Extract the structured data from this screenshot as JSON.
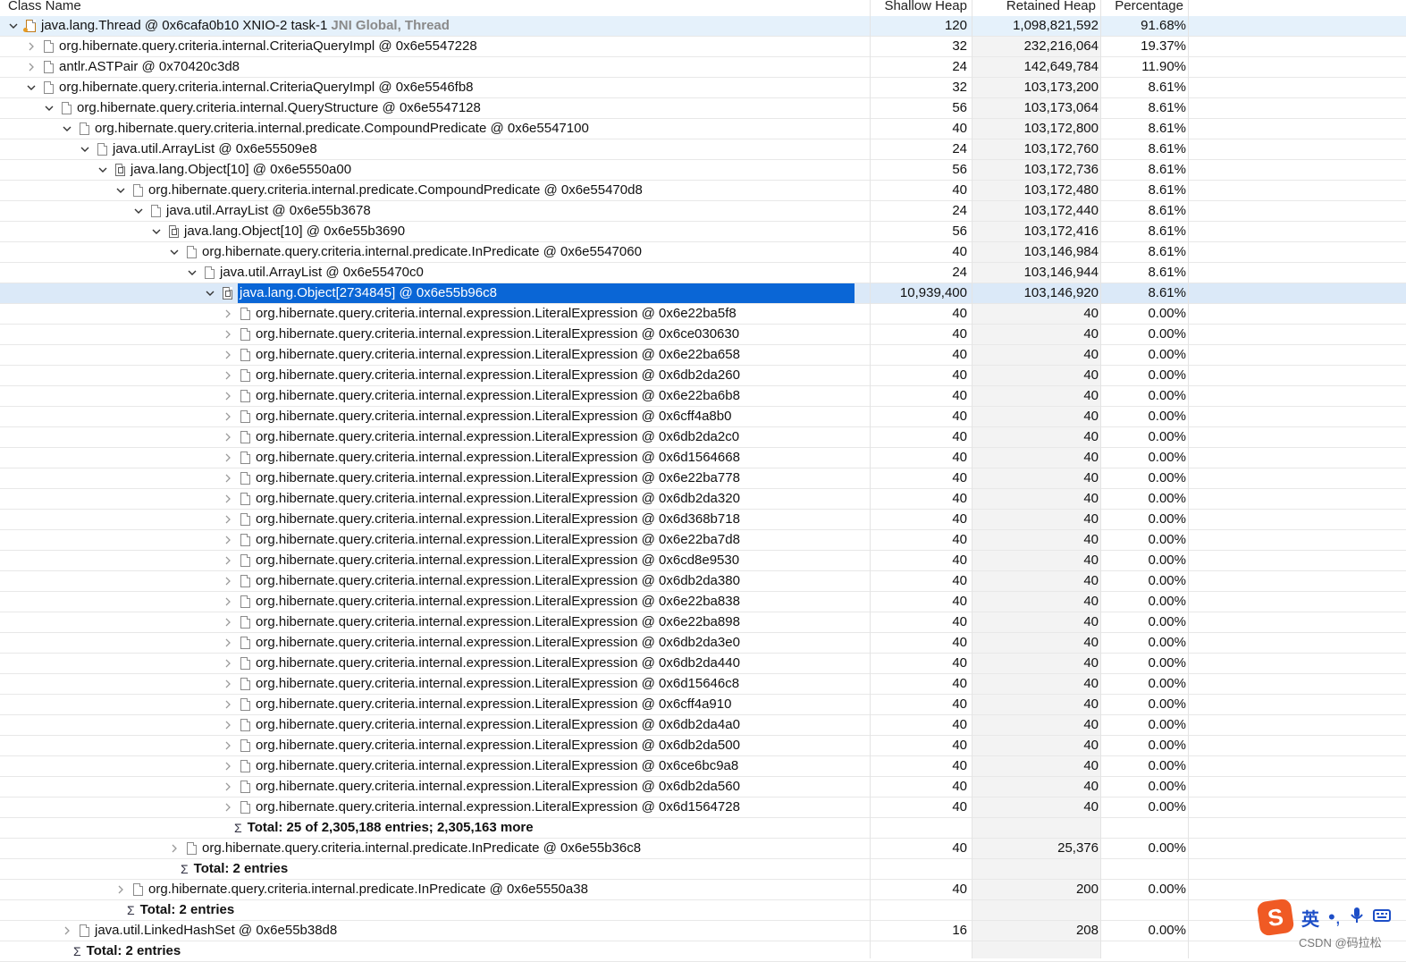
{
  "columns": [
    "Class Name",
    "Shallow Heap",
    "Retained Heap",
    "Percentage"
  ],
  "rows": [
    {
      "depth": 0,
      "tog": "open",
      "icon": "thread",
      "name": "java.lang.Thread @ 0x6cafa0b10  XNIO-2 task-1",
      "gc": "JNI Global, Thread",
      "shallow": "120",
      "retained": "1,098,821,592",
      "pct": "91.68%"
    },
    {
      "depth": 1,
      "tog": "closed",
      "icon": "page",
      "name": "org.hibernate.query.criteria.internal.CriteriaQueryImpl @ 0x6e5547228",
      "shallow": "32",
      "retained": "232,216,064",
      "pct": "19.37%"
    },
    {
      "depth": 1,
      "tog": "closed",
      "icon": "page",
      "name": "antlr.ASTPair @ 0x70420c3d8",
      "shallow": "24",
      "retained": "142,649,784",
      "pct": "11.90%"
    },
    {
      "depth": 1,
      "tog": "open",
      "icon": "page",
      "name": "org.hibernate.query.criteria.internal.CriteriaQueryImpl @ 0x6e5546fb8",
      "shallow": "32",
      "retained": "103,173,200",
      "pct": "8.61%"
    },
    {
      "depth": 2,
      "tog": "open",
      "icon": "page",
      "name": "org.hibernate.query.criteria.internal.QueryStructure @ 0x6e5547128",
      "shallow": "56",
      "retained": "103,173,064",
      "pct": "8.61%"
    },
    {
      "depth": 3,
      "tog": "open",
      "icon": "page",
      "name": "org.hibernate.query.criteria.internal.predicate.CompoundPredicate @ 0x6e5547100",
      "shallow": "40",
      "retained": "103,172,800",
      "pct": "8.61%"
    },
    {
      "depth": 4,
      "tog": "open",
      "icon": "page",
      "name": "java.util.ArrayList @ 0x6e55509e8",
      "shallow": "24",
      "retained": "103,172,760",
      "pct": "8.61%"
    },
    {
      "depth": 5,
      "tog": "open",
      "icon": "array",
      "name": "java.lang.Object[10] @ 0x6e5550a00",
      "shallow": "56",
      "retained": "103,172,736",
      "pct": "8.61%"
    },
    {
      "depth": 6,
      "tog": "open",
      "icon": "page",
      "name": "org.hibernate.query.criteria.internal.predicate.CompoundPredicate @ 0x6e55470d8",
      "shallow": "40",
      "retained": "103,172,480",
      "pct": "8.61%"
    },
    {
      "depth": 7,
      "tog": "open",
      "icon": "page",
      "name": "java.util.ArrayList @ 0x6e55b3678",
      "shallow": "24",
      "retained": "103,172,440",
      "pct": "8.61%"
    },
    {
      "depth": 8,
      "tog": "open",
      "icon": "array",
      "name": "java.lang.Object[10] @ 0x6e55b3690",
      "shallow": "56",
      "retained": "103,172,416",
      "pct": "8.61%"
    },
    {
      "depth": 9,
      "tog": "open",
      "icon": "page",
      "name": "org.hibernate.query.criteria.internal.predicate.InPredicate @ 0x6e5547060",
      "shallow": "40",
      "retained": "103,146,984",
      "pct": "8.61%"
    },
    {
      "depth": 10,
      "tog": "open",
      "icon": "page",
      "name": "java.util.ArrayList @ 0x6e55470c0",
      "shallow": "24",
      "retained": "103,146,944",
      "pct": "8.61%"
    },
    {
      "depth": 11,
      "tog": "open",
      "icon": "array",
      "name": "java.lang.Object[2734845] @ 0x6e55b96c8",
      "shallow": "10,939,400",
      "retained": "103,146,920",
      "pct": "8.61%",
      "selected": true
    },
    {
      "depth": 12,
      "tog": "closed",
      "icon": "page",
      "name": "org.hibernate.query.criteria.internal.expression.LiteralExpression @ 0x6e22ba5f8",
      "shallow": "40",
      "retained": "40",
      "pct": "0.00%"
    },
    {
      "depth": 12,
      "tog": "closed",
      "icon": "page",
      "name": "org.hibernate.query.criteria.internal.expression.LiteralExpression @ 0x6ce030630",
      "shallow": "40",
      "retained": "40",
      "pct": "0.00%"
    },
    {
      "depth": 12,
      "tog": "closed",
      "icon": "page",
      "name": "org.hibernate.query.criteria.internal.expression.LiteralExpression @ 0x6e22ba658",
      "shallow": "40",
      "retained": "40",
      "pct": "0.00%"
    },
    {
      "depth": 12,
      "tog": "closed",
      "icon": "page",
      "name": "org.hibernate.query.criteria.internal.expression.LiteralExpression @ 0x6db2da260",
      "shallow": "40",
      "retained": "40",
      "pct": "0.00%"
    },
    {
      "depth": 12,
      "tog": "closed",
      "icon": "page",
      "name": "org.hibernate.query.criteria.internal.expression.LiteralExpression @ 0x6e22ba6b8",
      "shallow": "40",
      "retained": "40",
      "pct": "0.00%"
    },
    {
      "depth": 12,
      "tog": "closed",
      "icon": "page",
      "name": "org.hibernate.query.criteria.internal.expression.LiteralExpression @ 0x6cff4a8b0",
      "shallow": "40",
      "retained": "40",
      "pct": "0.00%"
    },
    {
      "depth": 12,
      "tog": "closed",
      "icon": "page",
      "name": "org.hibernate.query.criteria.internal.expression.LiteralExpression @ 0x6db2da2c0",
      "shallow": "40",
      "retained": "40",
      "pct": "0.00%"
    },
    {
      "depth": 12,
      "tog": "closed",
      "icon": "page",
      "name": "org.hibernate.query.criteria.internal.expression.LiteralExpression @ 0x6d1564668",
      "shallow": "40",
      "retained": "40",
      "pct": "0.00%"
    },
    {
      "depth": 12,
      "tog": "closed",
      "icon": "page",
      "name": "org.hibernate.query.criteria.internal.expression.LiteralExpression @ 0x6e22ba778",
      "shallow": "40",
      "retained": "40",
      "pct": "0.00%"
    },
    {
      "depth": 12,
      "tog": "closed",
      "icon": "page",
      "name": "org.hibernate.query.criteria.internal.expression.LiteralExpression @ 0x6db2da320",
      "shallow": "40",
      "retained": "40",
      "pct": "0.00%"
    },
    {
      "depth": 12,
      "tog": "closed",
      "icon": "page",
      "name": "org.hibernate.query.criteria.internal.expression.LiteralExpression @ 0x6d368b718",
      "shallow": "40",
      "retained": "40",
      "pct": "0.00%"
    },
    {
      "depth": 12,
      "tog": "closed",
      "icon": "page",
      "name": "org.hibernate.query.criteria.internal.expression.LiteralExpression @ 0x6e22ba7d8",
      "shallow": "40",
      "retained": "40",
      "pct": "0.00%"
    },
    {
      "depth": 12,
      "tog": "closed",
      "icon": "page",
      "name": "org.hibernate.query.criteria.internal.expression.LiteralExpression @ 0x6cd8e9530",
      "shallow": "40",
      "retained": "40",
      "pct": "0.00%"
    },
    {
      "depth": 12,
      "tog": "closed",
      "icon": "page",
      "name": "org.hibernate.query.criteria.internal.expression.LiteralExpression @ 0x6db2da380",
      "shallow": "40",
      "retained": "40",
      "pct": "0.00%"
    },
    {
      "depth": 12,
      "tog": "closed",
      "icon": "page",
      "name": "org.hibernate.query.criteria.internal.expression.LiteralExpression @ 0x6e22ba838",
      "shallow": "40",
      "retained": "40",
      "pct": "0.00%"
    },
    {
      "depth": 12,
      "tog": "closed",
      "icon": "page",
      "name": "org.hibernate.query.criteria.internal.expression.LiteralExpression @ 0x6e22ba898",
      "shallow": "40",
      "retained": "40",
      "pct": "0.00%"
    },
    {
      "depth": 12,
      "tog": "closed",
      "icon": "page",
      "name": "org.hibernate.query.criteria.internal.expression.LiteralExpression @ 0x6db2da3e0",
      "shallow": "40",
      "retained": "40",
      "pct": "0.00%"
    },
    {
      "depth": 12,
      "tog": "closed",
      "icon": "page",
      "name": "org.hibernate.query.criteria.internal.expression.LiteralExpression @ 0x6db2da440",
      "shallow": "40",
      "retained": "40",
      "pct": "0.00%"
    },
    {
      "depth": 12,
      "tog": "closed",
      "icon": "page",
      "name": "org.hibernate.query.criteria.internal.expression.LiteralExpression @ 0x6d15646c8",
      "shallow": "40",
      "retained": "40",
      "pct": "0.00%"
    },
    {
      "depth": 12,
      "tog": "closed",
      "icon": "page",
      "name": "org.hibernate.query.criteria.internal.expression.LiteralExpression @ 0x6cff4a910",
      "shallow": "40",
      "retained": "40",
      "pct": "0.00%"
    },
    {
      "depth": 12,
      "tog": "closed",
      "icon": "page",
      "name": "org.hibernate.query.criteria.internal.expression.LiteralExpression @ 0x6db2da4a0",
      "shallow": "40",
      "retained": "40",
      "pct": "0.00%"
    },
    {
      "depth": 12,
      "tog": "closed",
      "icon": "page",
      "name": "org.hibernate.query.criteria.internal.expression.LiteralExpression @ 0x6db2da500",
      "shallow": "40",
      "retained": "40",
      "pct": "0.00%"
    },
    {
      "depth": 12,
      "tog": "closed",
      "icon": "page",
      "name": "org.hibernate.query.criteria.internal.expression.LiteralExpression @ 0x6ce6bc9a8",
      "shallow": "40",
      "retained": "40",
      "pct": "0.00%"
    },
    {
      "depth": 12,
      "tog": "closed",
      "icon": "page",
      "name": "org.hibernate.query.criteria.internal.expression.LiteralExpression @ 0x6db2da560",
      "shallow": "40",
      "retained": "40",
      "pct": "0.00%"
    },
    {
      "depth": 12,
      "tog": "closed",
      "icon": "page",
      "name": "org.hibernate.query.criteria.internal.expression.LiteralExpression @ 0x6d1564728",
      "shallow": "40",
      "retained": "40",
      "pct": "0.00%"
    },
    {
      "depth": 12,
      "tog": "none",
      "icon": "sigma-more",
      "name": "Total: 25 of 2,305,188 entries; 2,305,163 more",
      "total": true
    },
    {
      "depth": 9,
      "tog": "closed",
      "icon": "page",
      "name": "org.hibernate.query.criteria.internal.predicate.InPredicate @ 0x6e55b36c8",
      "shallow": "40",
      "retained": "25,376",
      "pct": "0.00%"
    },
    {
      "depth": 9,
      "tog": "none",
      "icon": "sigma",
      "name": "Total: 2 entries",
      "total": true
    },
    {
      "depth": 6,
      "tog": "closed",
      "icon": "page",
      "name": "org.hibernate.query.criteria.internal.predicate.InPredicate @ 0x6e5550a38",
      "shallow": "40",
      "retained": "200",
      "pct": "0.00%"
    },
    {
      "depth": 6,
      "tog": "none",
      "icon": "sigma",
      "name": "Total: 2 entries",
      "total": true
    },
    {
      "depth": 3,
      "tog": "closed",
      "icon": "page",
      "name": "java.util.LinkedHashSet @ 0x6e55b38d8",
      "shallow": "16",
      "retained": "208",
      "pct": "0.00%"
    },
    {
      "depth": 3,
      "tog": "none",
      "icon": "sigma",
      "name": "Total: 2 entries",
      "total": true
    }
  ],
  "ime": {
    "logo": "S",
    "mode": "英",
    "punct": "•,"
  },
  "watermark": "CSDN @码拉松",
  "colors": {
    "selection": "#0a66d6",
    "accent_gc": "#8a8a8a",
    "ime_brand": "#f05a24"
  }
}
